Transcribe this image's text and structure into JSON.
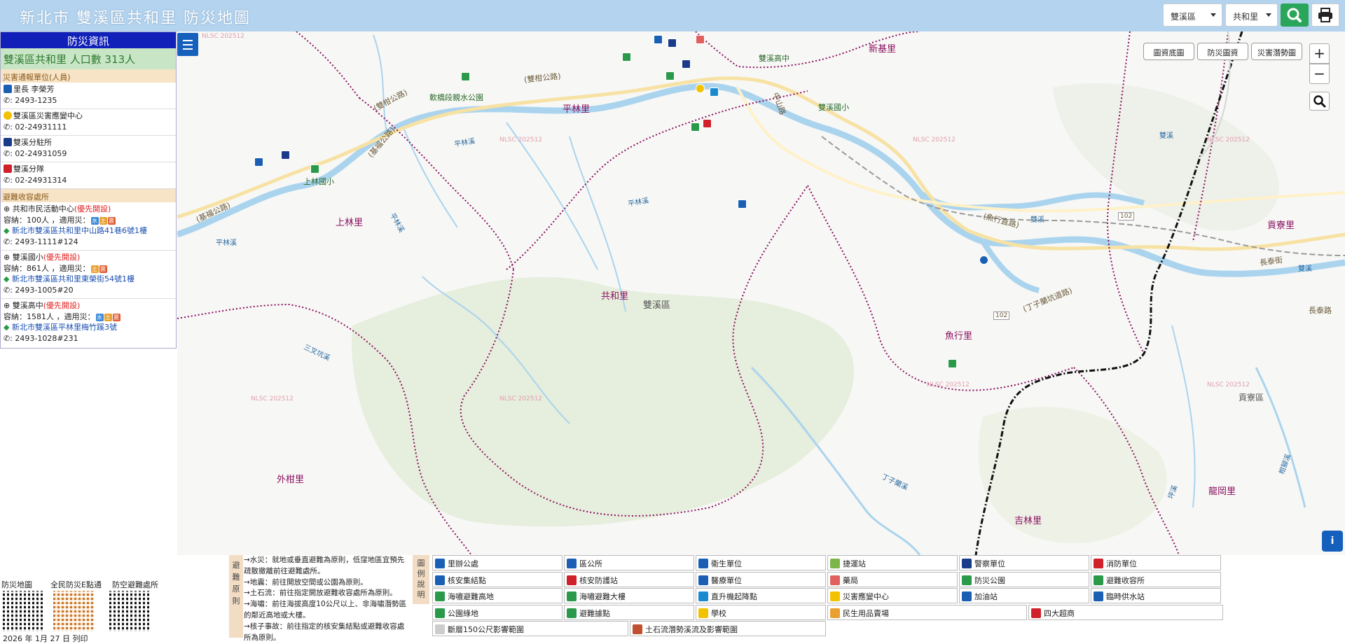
{
  "header": {
    "title": "新北市 雙溪區共和里 防災地圖",
    "district_select": "雙溪區",
    "village_select": "共和里"
  },
  "panel": {
    "heading": "防災資訊",
    "population": "雙溪區共和里  人口數   313人",
    "contacts_heading": "災害通報單位(人員)",
    "contacts": [
      {
        "name": "里長 李榮芳",
        "phone": ": 2493-1235",
        "color": "#1a5fb4"
      },
      {
        "name": "雙溪區災害應變中心",
        "phone": ": 02-24931111",
        "color": "#f2c200"
      },
      {
        "name": "雙溪分駐所",
        "phone": ": 02-24931059",
        "color": "#1a3a8a"
      },
      {
        "name": "雙溪分隊",
        "phone": ": 02-24931314",
        "color": "#d0202a"
      }
    ],
    "shelters_heading": "避難收容處所",
    "shelters": [
      {
        "name": "共和市民活動中心",
        "priority": "(優先開設)",
        "capacity": "容納：100人 ，適用災：",
        "tags": [
          "水",
          "土",
          "震"
        ],
        "address": "新北市雙溪區共和里中山路41巷6號1樓",
        "phone": ": 2493-1111#124"
      },
      {
        "name": "雙溪國小",
        "priority": "(優先開設)",
        "capacity": "容納：861人 ，適用災：",
        "tags": [
          "土",
          "震"
        ],
        "address": "新北市雙溪區共和里東榮街54號1樓",
        "phone": ": 2493-1005#20"
      },
      {
        "name": "雙溪高中",
        "priority": "(優先開設)",
        "capacity": "容納：1581人 ，適用災：",
        "tags": [
          "水",
          "土",
          "震"
        ],
        "address": "新北市雙溪區平林里梅竹蹊3號",
        "phone": ": 2493-1028#231"
      }
    ]
  },
  "map_controls": {
    "layers": [
      "圖資底圖",
      "防災圖資",
      "災害潛勢圖"
    ],
    "zoom_in": "+",
    "zoom_out": "−",
    "info": "i"
  },
  "map_labels": {
    "villages": [
      {
        "text": "新基里"
      },
      {
        "text": "平林里"
      },
      {
        "text": "上林里"
      },
      {
        "text": "共和里"
      },
      {
        "text": "魚行里"
      },
      {
        "text": "貢寮里"
      },
      {
        "text": "外柑里"
      },
      {
        "text": "吉林里"
      },
      {
        "text": "龍岡里"
      },
      {
        "text": "貢寮區"
      },
      {
        "text": "雙溪區"
      }
    ],
    "roads": [
      "(雙柑公路)",
      "(雙柑公路)",
      "(基福公路)",
      "(基福公路)",
      "(魚行直路)",
      "(丁子蘭坑道路)",
      "中山路",
      "長泰路",
      "長泰街",
      "102",
      "102"
    ],
    "water": [
      "平林溪",
      "平林溪",
      "平林溪",
      "平林溪",
      "雙溪",
      "雙溪",
      "三叉坑溪",
      "丁子蘭溪",
      "柑腳溪",
      "坪溪",
      "雙溪"
    ],
    "places": [
      "軟橋段親水公園",
      "上林國小",
      "雙溪高中",
      "雙溪國小"
    ],
    "watermark": "NLSC 202512"
  },
  "qr_codes": [
    {
      "label": "防災地圖"
    },
    {
      "label": "全民防災E點通"
    },
    {
      "label": "防空避難處所"
    }
  ],
  "date": "2026 年 1月 27 日 列印",
  "rules": {
    "tab": "避\n難\n原\n則",
    "items": [
      "→水災：就地或垂直避難為原則，低窪地區宜預先疏散撤離前往避難處所。",
      "→地震：前往開放空間或公園為原則。",
      "→土石流：前往指定開放避難收容處所為原則。",
      "→海嘯：前往海拔高度10公尺以上、非海嘯潛勢區的鄰近高地或大樓。",
      "→核子事故：前往指定的核安集結點或避難收容處所為原則。"
    ]
  },
  "legend": {
    "tab": "圖\n例\n說\n明",
    "items": [
      {
        "label": "里辦公處",
        "color": "#1a5fb4"
      },
      {
        "label": "區公所",
        "color": "#1a5fb4"
      },
      {
        "label": "衛生單位",
        "color": "#1a5fb4"
      },
      {
        "label": "捷運站",
        "color": "#7ab648"
      },
      {
        "label": "警察單位",
        "color": "#1a3a8a"
      },
      {
        "label": "消防單位",
        "color": "#d0202a"
      },
      {
        "label": "核安集結點",
        "color": "#1a5fb4"
      },
      {
        "label": "核安防護站",
        "color": "#d0202a"
      },
      {
        "label": "醫療單位",
        "color": "#1a5fb4"
      },
      {
        "label": "藥局",
        "color": "#e06060"
      },
      {
        "label": "防災公園",
        "color": "#2a9a4a"
      },
      {
        "label": "避難收容所",
        "color": "#2a9a4a"
      },
      {
        "label": "海嘯避難高地",
        "color": "#2a9a4a"
      },
      {
        "label": "海嘯避難大樓",
        "color": "#2a9a4a"
      },
      {
        "label": "直升機起降點",
        "color": "#1a8ad0"
      },
      {
        "label": "災害應變中心",
        "color": "#f2c200"
      },
      {
        "label": "加油站",
        "color": "#1a5fb4"
      },
      {
        "label": "臨時供水站",
        "color": "#1a5fb4"
      },
      {
        "label": "公園綠地",
        "color": "#2a9a4a"
      },
      {
        "label": "避難據點",
        "color": "#2a9a4a"
      },
      {
        "label": "學校",
        "color": "#f2c200"
      },
      {
        "label": "民生用品賣場",
        "color": "#e8a030"
      },
      {
        "label": "四大超商",
        "color": "#d0202a"
      },
      {
        "label": "斷層150公尺影響範圍",
        "color": "#cccccc"
      },
      {
        "label": "土石流潛勢溪流及影響範圍",
        "color": "#c05030"
      }
    ]
  },
  "colors": {
    "header_bg": "#b3d3ee",
    "panel_head": "#1020b8",
    "accent_blue": "#1560bd",
    "search_green": "#2aa65a",
    "boundary": "#8a1060"
  }
}
